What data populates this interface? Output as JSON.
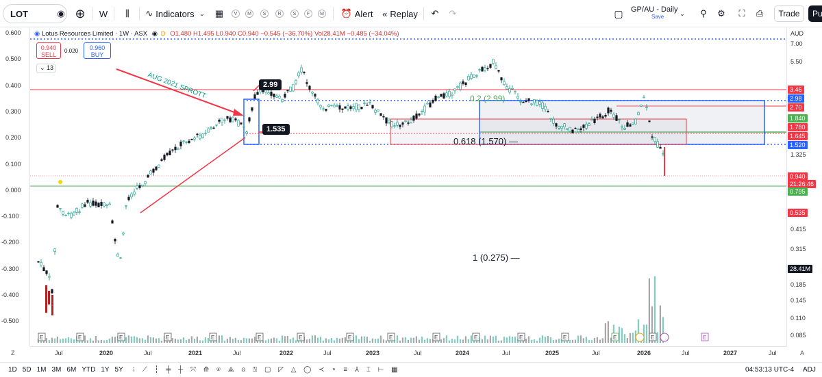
{
  "toolbar": {
    "symbol": "LOT",
    "interval": "W",
    "indicators_label": "Indicators",
    "layout_letters": [
      "V",
      "M",
      "S",
      "R",
      "S",
      "F",
      "M"
    ],
    "alert_label": "Alert",
    "replay_label": "Replay",
    "layout_name": "GP/AU - Daily",
    "save_label": "Save",
    "trade_label": "Trade",
    "publish_label": "Pu"
  },
  "legend": {
    "title": "Lotus Resources Limited · 1W · ASX",
    "ohlc": "O1.480 H1.495 L0.940 C0.940 −0.545 (−36.70%) Vol28.41M −0.485 (−34.04%)",
    "sell_price": "0.940",
    "sell_label": "SELL",
    "spread": "0.020",
    "buy_price": "0.960",
    "buy_label": "BUY",
    "indicator_count": "13"
  },
  "left_axis": [
    "0.600",
    "0.500",
    "0.400",
    "0.300",
    "0.200",
    "0.100",
    "0.000",
    "-0.100",
    "-0.200",
    "-0.300",
    "-0.400",
    "-0.500"
  ],
  "right_axis": {
    "currency": "AUD",
    "labels": [
      "7.00",
      "5.50",
      "1.325",
      "0.415",
      "0.315",
      "0.185",
      "0.145",
      "0.110",
      "0.085"
    ],
    "tags": [
      {
        "text": "3.46",
        "color": "#f23645"
      },
      {
        "text": "2.98",
        "color": "#2962ff"
      },
      {
        "text": "2.70",
        "color": "#f23645"
      },
      {
        "text": "1.840",
        "color": "#4caf50"
      },
      {
        "text": "1.780",
        "color": "#f23645"
      },
      {
        "text": "1.645",
        "color": "#f23645"
      },
      {
        "text": "1.520",
        "color": "#2962ff"
      },
      {
        "text": "0.940",
        "color": "#f23645"
      },
      {
        "text": "21:26:46",
        "color": "#f23645"
      },
      {
        "text": "0.795",
        "color": "#4caf50"
      },
      {
        "text": "0.535",
        "color": "#f23645"
      },
      {
        "text": "28.41M",
        "color": "#131722"
      }
    ]
  },
  "annotations": {
    "sprott": "AUG 2021 SPROTT",
    "price_high_box": "2.99",
    "price_low_box": "1.535",
    "fib_02": "0.2 (2.99)",
    "fib_0618": "0.618 (1.570)",
    "fib_1": "1 (0.275)"
  },
  "time_axis": [
    {
      "t": "Jul",
      "b": false
    },
    {
      "t": "2020",
      "b": true
    },
    {
      "t": "Jul",
      "b": false
    },
    {
      "t": "2021",
      "b": true
    },
    {
      "t": "Jul",
      "b": false
    },
    {
      "t": "2022",
      "b": true
    },
    {
      "t": "Jul",
      "b": false
    },
    {
      "t": "2023",
      "b": true
    },
    {
      "t": "Jul",
      "b": false
    },
    {
      "t": "2024",
      "b": true
    },
    {
      "t": "Jul",
      "b": false
    },
    {
      "t": "2025",
      "b": true
    },
    {
      "t": "Jul",
      "b": false
    },
    {
      "t": "2026",
      "b": true
    },
    {
      "t": "Jul",
      "b": false
    },
    {
      "t": "2027",
      "b": true
    },
    {
      "t": "Jul",
      "b": false
    }
  ],
  "bottom": {
    "ranges": [
      "1D",
      "5D",
      "1M",
      "3M",
      "6M",
      "YTD",
      "1Y",
      "5Y"
    ],
    "clock": "04:53:13 UTC-4",
    "adj": "ADJ"
  },
  "colors": {
    "up": "#089981",
    "down": "#f23645",
    "blue": "#2962ff",
    "green": "#4caf50",
    "red": "#f23645"
  }
}
